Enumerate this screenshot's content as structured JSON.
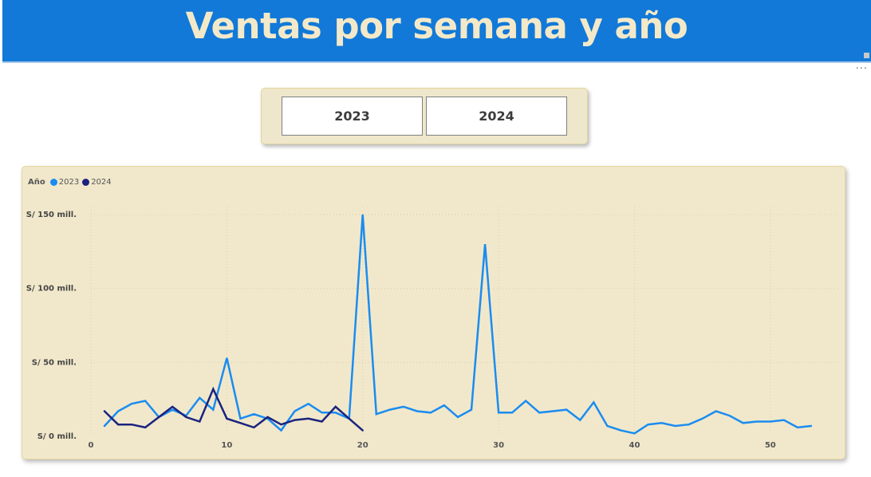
{
  "header": {
    "title": "Ventas por semana y año"
  },
  "slicer": {
    "options": [
      "2023",
      "2024"
    ]
  },
  "chart_data": {
    "type": "line",
    "title": "",
    "legend": {
      "title": "Año",
      "placement": "top-left"
    },
    "xlabel": "",
    "ylabel": "",
    "xlim": [
      0,
      55
    ],
    "ylim": [
      0,
      150
    ],
    "x_ticks": [
      0,
      10,
      20,
      30,
      40,
      50
    ],
    "y_ticks": [
      0,
      50,
      100,
      150
    ],
    "y_tick_labels": [
      "S/ 0 mill.",
      "S/ 50 mill.",
      "S/ 100 mill.",
      "S/ 150 mill."
    ],
    "grid": true,
    "series": [
      {
        "name": "2023",
        "color": "#1a8cf0",
        "x": [
          1,
          2,
          3,
          4,
          5,
          6,
          7,
          8,
          9,
          10,
          11,
          12,
          13,
          14,
          15,
          16,
          17,
          18,
          19,
          20,
          21,
          22,
          23,
          24,
          25,
          26,
          27,
          28,
          29,
          30,
          31,
          32,
          33,
          34,
          35,
          36,
          37,
          38,
          39,
          40,
          41,
          42,
          43,
          44,
          45,
          46,
          47,
          48,
          49,
          50,
          51,
          52,
          53
        ],
        "values": [
          7,
          17,
          22,
          24,
          13,
          18,
          14,
          26,
          18,
          53,
          12,
          15,
          12,
          4,
          17,
          22,
          16,
          16,
          12,
          150,
          15,
          18,
          20,
          17,
          16,
          21,
          13,
          18,
          130,
          16,
          16,
          24,
          16,
          17,
          18,
          11,
          23,
          7,
          4,
          2,
          8,
          9,
          7,
          8,
          12,
          17,
          14,
          9,
          10,
          10,
          11,
          6,
          7
        ]
      },
      {
        "name": "2024",
        "color": "#1a237e",
        "x": [
          1,
          2,
          3,
          4,
          5,
          6,
          7,
          8,
          9,
          10,
          11,
          12,
          13,
          14,
          15,
          16,
          17,
          18,
          19,
          20
        ],
        "values": [
          17,
          8,
          8,
          6,
          13,
          20,
          13,
          10,
          32,
          12,
          9,
          6,
          13,
          8,
          11,
          12,
          10,
          20,
          12,
          4
        ]
      }
    ]
  }
}
